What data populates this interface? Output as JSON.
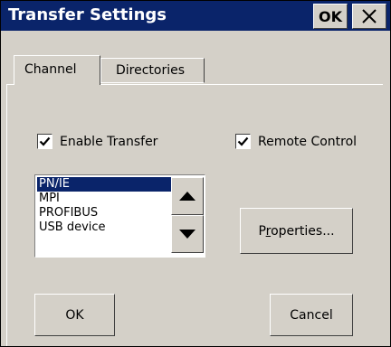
{
  "dialog": {
    "title": "Transfer Settings",
    "ok_title_label": "OK",
    "close_icon": "close-icon",
    "title_bar_color": "#0a246a",
    "face_color": "#d4d0c8"
  },
  "tabs": [
    {
      "label": "Channel",
      "active": true
    },
    {
      "label": "Directories",
      "active": false
    }
  ],
  "channel": {
    "enable_transfer": {
      "label": "Enable Transfer",
      "checked": true
    },
    "remote_control": {
      "label": "Remote Control",
      "checked": true
    },
    "list": {
      "items": [
        "PN/IE",
        "MPI",
        "PROFIBUS",
        "USB device"
      ],
      "selected": "PN/IE",
      "up_icon": "triangle-up-icon",
      "down_icon": "triangle-down-icon"
    },
    "properties_label_pre": "P",
    "properties_label_ul": "r",
    "properties_label_post": "operties..."
  },
  "footer": {
    "ok_label": "OK",
    "cancel_label": "Cancel"
  }
}
